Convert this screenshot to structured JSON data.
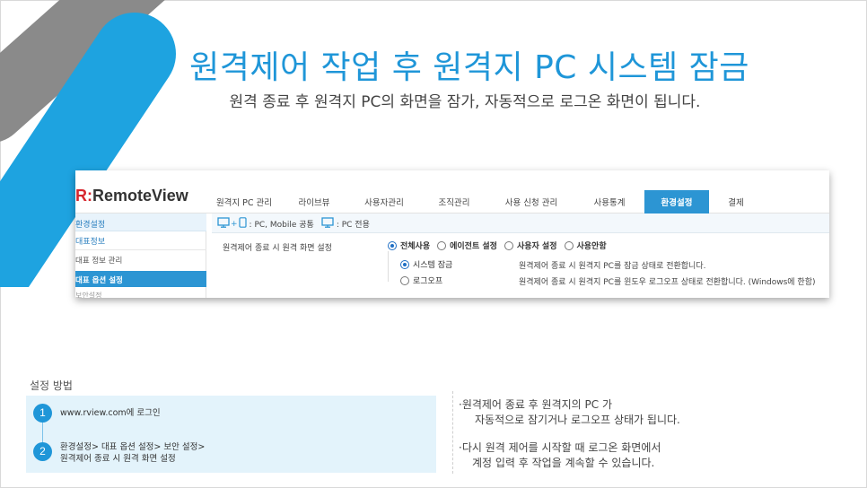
{
  "title": "원격제어 작업 후 원격지 PC 시스템 잠금",
  "subtitle": "원격 종료 후 원격지 PC의 화면을 잠가, 자동적으로 로그온 화면이 됩니다.",
  "colors": {
    "accent": "#1f96d8",
    "nav_active": "#2c95d3",
    "logo_mark": "#d7262d",
    "deco_gray": "#8a8a8a"
  },
  "app": {
    "logo_mark": "R:",
    "logo_text": "RemoteView",
    "nav": [
      {
        "label": "원격지 PC 관리",
        "active": false
      },
      {
        "label": "라이브뷰",
        "active": false
      },
      {
        "label": "사용자관리",
        "active": false
      },
      {
        "label": "조직관리",
        "active": false
      },
      {
        "label": "사용 신청 관리",
        "active": false
      },
      {
        "label": "사용통계",
        "active": false
      },
      {
        "label": "환경설정",
        "active": true
      },
      {
        "label": "결제",
        "active": false
      }
    ],
    "sidebar": {
      "header": "환경설정",
      "items": [
        "대표정보",
        "대표 정보 관리",
        "대표 옵션 설정",
        "보안설정"
      ]
    },
    "legend": {
      "pc_mobile": ": PC, Mobile 공통",
      "pc_only": ": PC 전용"
    },
    "setting_label": "원격제어 종료 시 원격 화면 설정",
    "options": [
      {
        "label": "전체사용",
        "selected": true
      },
      {
        "label": "에이전트 설정",
        "selected": false
      },
      {
        "label": "사용자 설정",
        "selected": false
      },
      {
        "label": "사용안함",
        "selected": false
      }
    ],
    "sub_options": [
      {
        "label": "시스템 잠금",
        "selected": true,
        "desc": "원격제어 종료 시 원격지 PC를 잠금 상태로 전환합니다."
      },
      {
        "label": "로그오프",
        "selected": false,
        "desc": "원격제어 종료 시 원격지 PC를 윈도우 로그오프 상태로 전환합니다. (Windows에 한함)"
      }
    ]
  },
  "how": {
    "label": "설정 방법",
    "steps": [
      {
        "num": "1",
        "line1": "www.rview.com에 로그인",
        "line2": ""
      },
      {
        "num": "2",
        "line1": "환경설정> 대표 옵션 설정> 보안 설정>",
        "line2": "원격제어 종료 시 원격 화면 설정"
      }
    ]
  },
  "notes": [
    {
      "line1": "·원격제어 종료 후 원격지의 PC 가",
      "line2": "자동적으로 잠기거나 로그오프 상태가 됩니다."
    },
    {
      "line1": "·다시 원격 제어를 시작할 때 로그온 화면에서",
      "line2": "계정 입력 후 작업을 계속할 수 있습니다."
    }
  ]
}
